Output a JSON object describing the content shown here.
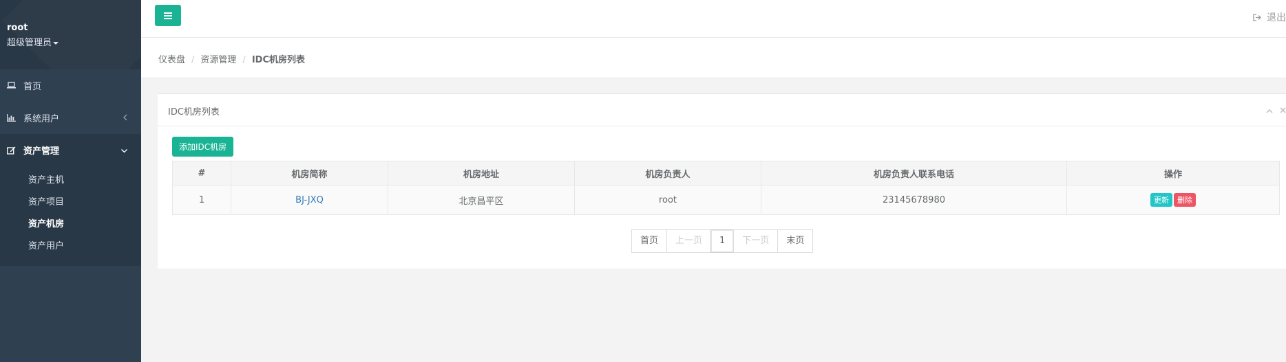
{
  "user": {
    "name": "root",
    "role": "超级管理员"
  },
  "nav": {
    "home": "首页",
    "system_users": "系统用户",
    "asset_mgmt": "资产管理",
    "sub_items": [
      "资产主机",
      "资产项目",
      "资产机房",
      "资产用户"
    ]
  },
  "topbar": {
    "logout_label": "退出"
  },
  "breadcrumb": {
    "items": [
      "仪表盘",
      "资源管理",
      "IDC机房列表"
    ]
  },
  "panel": {
    "title": "IDC机房列表",
    "add_label": "添加IDC机房"
  },
  "table": {
    "headers": [
      "#",
      "机房简称",
      "机房地址",
      "机房负责人",
      "机房负责人联系电话",
      "操作"
    ],
    "rows": [
      {
        "index": "1",
        "name": "BJ-JXQ",
        "address": "北京昌平区",
        "owner": "root",
        "phone": "23145678980",
        "update": "更新",
        "delete": "删除"
      }
    ]
  },
  "pagination": {
    "first": "首页",
    "prev": "上一页",
    "current": "1",
    "next": "下一页",
    "last": "末页"
  },
  "colors": {
    "sidebar": "#2f4050",
    "primary": "#1ab394",
    "info": "#23c6c8",
    "danger": "#ed5565",
    "link": "#337ab7"
  }
}
